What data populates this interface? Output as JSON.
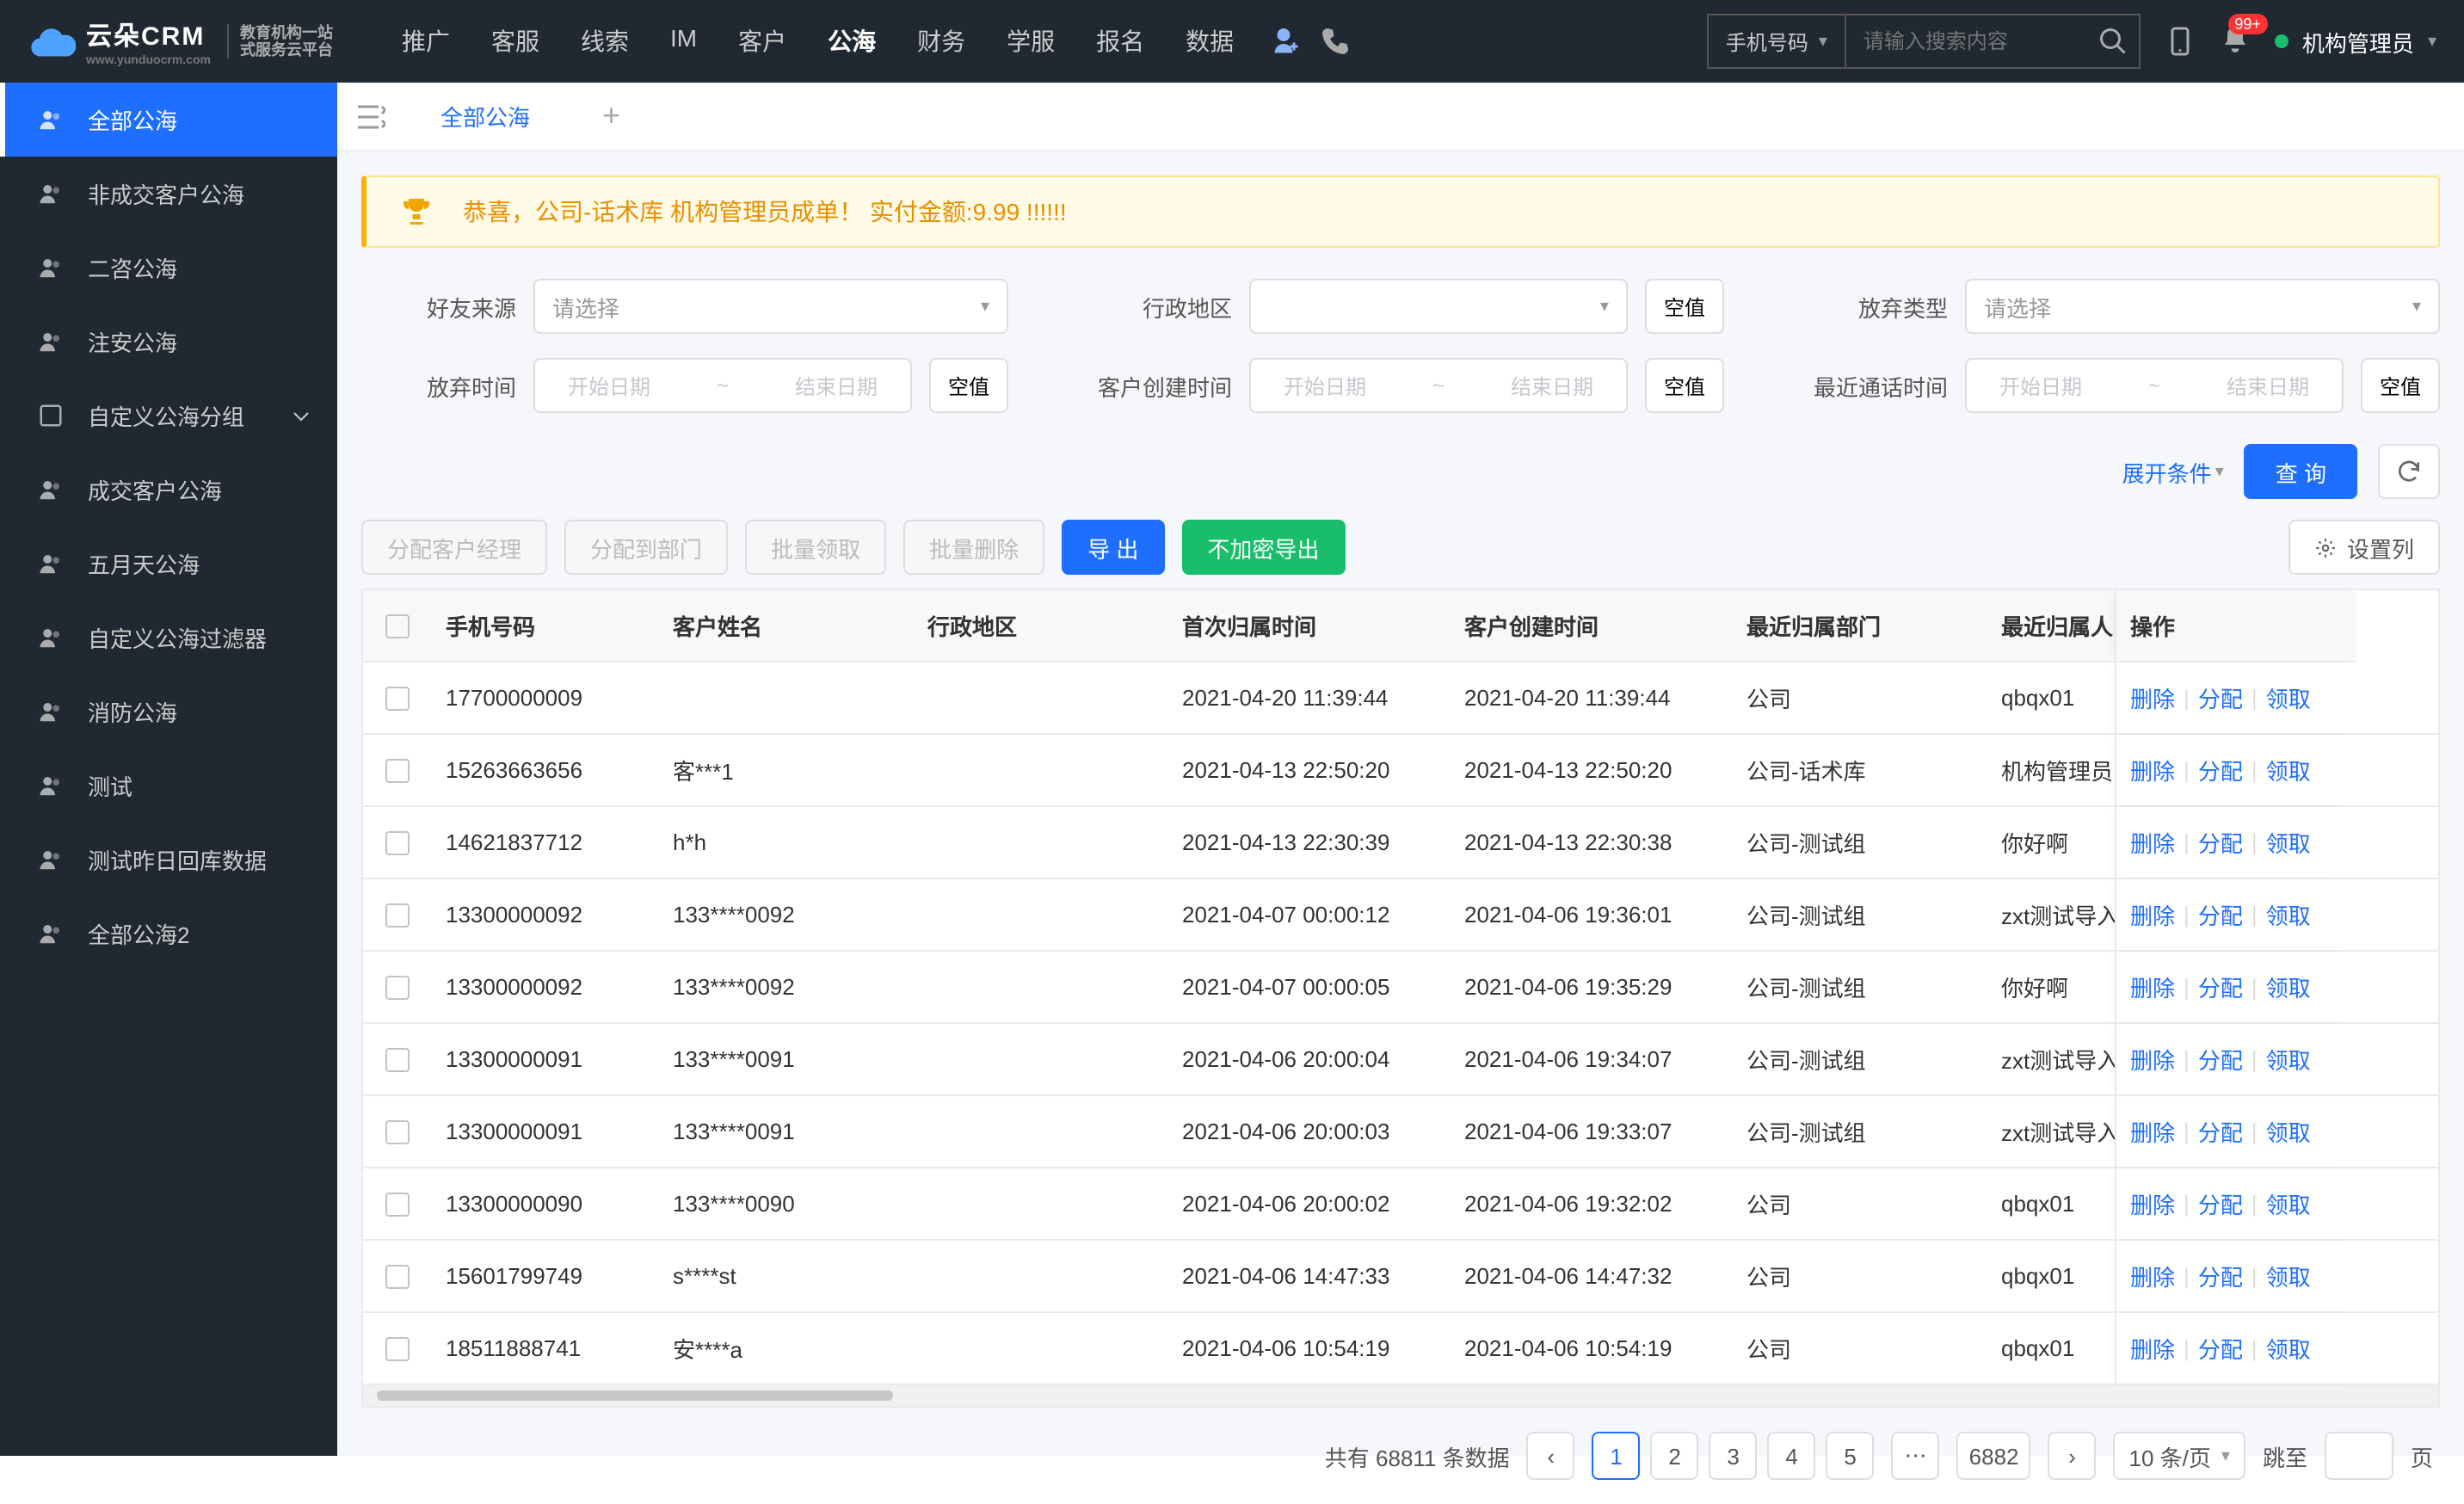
{
  "header": {
    "logo_main": "云朵CRM",
    "logo_url": "www.yunduocrm.com",
    "logo_sub1": "教育机构一站",
    "logo_sub2": "式服务云平台",
    "nav": [
      "推广",
      "客服",
      "线索",
      "IM",
      "客户",
      "公海",
      "财务",
      "学服",
      "报名",
      "数据"
    ],
    "nav_active": 5,
    "search_type": "手机号码",
    "search_placeholder": "请输入搜索内容",
    "badge": "99+",
    "user": "机构管理员"
  },
  "sidebar": {
    "items": [
      {
        "label": "全部公海",
        "active": true
      },
      {
        "label": "非成交客户公海"
      },
      {
        "label": "二咨公海"
      },
      {
        "label": "注安公海"
      },
      {
        "label": "自定义公海分组",
        "expand": true,
        "box": true
      },
      {
        "label": "成交客户公海"
      },
      {
        "label": "五月天公海"
      },
      {
        "label": "自定义公海过滤器"
      },
      {
        "label": "消防公海"
      },
      {
        "label": "测试"
      },
      {
        "label": "测试昨日回库数据"
      },
      {
        "label": "全部公海2"
      }
    ]
  },
  "tabs": {
    "menu_icon": "≡",
    "tab": "全部公海"
  },
  "banner": {
    "text": "恭喜，公司-话术库  机构管理员成单！   实付金额:9.99 !!!!!!"
  },
  "filters": {
    "labels": {
      "source": "好友来源",
      "region": "行政地区",
      "abandon_type": "放弃类型",
      "abandon_time": "放弃时间",
      "create_time": "客户创建时间",
      "call_time": "最近通话时间"
    },
    "select_ph": "请选择",
    "null_btn": "空值",
    "range_start": "开始日期",
    "range_sep": "~",
    "range_end": "结束日期",
    "expand": "展开条件",
    "query": "查 询",
    "export": "导 出"
  },
  "toolbar": {
    "assign_mgr": "分配客户经理",
    "assign_dept": "分配到部门",
    "batch_claim": "批量领取",
    "batch_del": "批量删除",
    "export": "导 出",
    "export_plain": "不加密导出",
    "cols": "设置列"
  },
  "table": {
    "headers": {
      "phone": "手机号码",
      "name": "客户姓名",
      "region": "行政地区",
      "first": "首次归属时间",
      "create": "客户创建时间",
      "dept": "最近归属部门",
      "owner": "最近归属人",
      "ops": "操作"
    },
    "ops": {
      "del": "删除",
      "assign": "分配",
      "claim": "领取"
    },
    "rows": [
      {
        "phone": "17700000009",
        "name": "",
        "region": "",
        "first": "2021-04-20 11:39:44",
        "create": "2021-04-20 11:39:44",
        "dept": "公司",
        "owner": "qbqx01"
      },
      {
        "phone": "15263663656",
        "name": "客***1",
        "region": "",
        "first": "2021-04-13 22:50:20",
        "create": "2021-04-13 22:50:20",
        "dept": "公司-话术库",
        "owner": "机构管理员"
      },
      {
        "phone": "14621837712",
        "name": "h*h",
        "region": "",
        "first": "2021-04-13 22:30:39",
        "create": "2021-04-13 22:30:38",
        "dept": "公司-测试组",
        "owner": "你好啊"
      },
      {
        "phone": "13300000092",
        "name": "133****0092",
        "region": "",
        "first": "2021-04-07 00:00:12",
        "create": "2021-04-06 19:36:01",
        "dept": "公司-测试组",
        "owner": "zxt测试导入"
      },
      {
        "phone": "13300000092",
        "name": "133****0092",
        "region": "",
        "first": "2021-04-07 00:00:05",
        "create": "2021-04-06 19:35:29",
        "dept": "公司-测试组",
        "owner": "你好啊"
      },
      {
        "phone": "13300000091",
        "name": "133****0091",
        "region": "",
        "first": "2021-04-06 20:00:04",
        "create": "2021-04-06 19:34:07",
        "dept": "公司-测试组",
        "owner": "zxt测试导入"
      },
      {
        "phone": "13300000091",
        "name": "133****0091",
        "region": "",
        "first": "2021-04-06 20:00:03",
        "create": "2021-04-06 19:33:07",
        "dept": "公司-测试组",
        "owner": "zxt测试导入"
      },
      {
        "phone": "13300000090",
        "name": "133****0090",
        "region": "",
        "first": "2021-04-06 20:00:02",
        "create": "2021-04-06 19:32:02",
        "dept": "公司",
        "owner": "qbqx01"
      },
      {
        "phone": "15601799749",
        "name": "s****st",
        "region": "",
        "first": "2021-04-06 14:47:33",
        "create": "2021-04-06 14:47:32",
        "dept": "公司",
        "owner": "qbqx01"
      },
      {
        "phone": "18511888741",
        "name": "安****a",
        "region": "",
        "first": "2021-04-06 10:54:19",
        "create": "2021-04-06 10:54:19",
        "dept": "公司",
        "owner": "qbqx01"
      }
    ]
  },
  "pager": {
    "total_prefix": "共有 ",
    "total": "68811",
    "total_suffix": " 条数据",
    "pages": [
      "1",
      "2",
      "3",
      "4",
      "5"
    ],
    "ellipsis": "⋯",
    "last": "6882",
    "size": "10 条/页",
    "jump_prefix": "跳至",
    "jump_suffix": "页"
  }
}
